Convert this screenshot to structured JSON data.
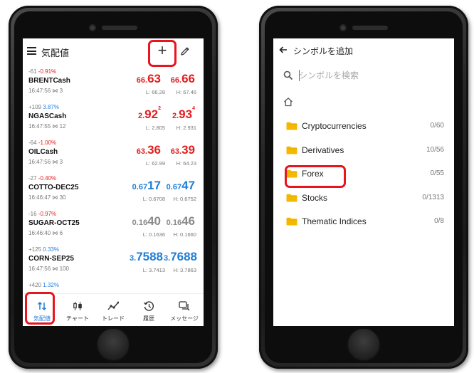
{
  "quotes_screen": {
    "title": "気配値",
    "add_button": "+",
    "rows": [
      {
        "chg_points": "-61",
        "chg_pct": "-0.91%",
        "dir": "neg",
        "symbol": "BRENTCash",
        "time": "16:47:56",
        "spread": "3",
        "bid": {
          "sm": "66.",
          "lg": "63",
          "sup": "",
          "color": "red"
        },
        "ask": {
          "sm": "66.",
          "lg": "66",
          "sup": "",
          "color": "red"
        },
        "low": "L: 66.28",
        "high": "H: 67.46"
      },
      {
        "chg_points": "+109",
        "chg_pct": "3.87%",
        "dir": "pos",
        "symbol": "NGASCash",
        "time": "16:47:55",
        "spread": "12",
        "bid": {
          "sm": "2.",
          "lg": "92",
          "sup": "2",
          "color": "red"
        },
        "ask": {
          "sm": "2.",
          "lg": "93",
          "sup": "4",
          "color": "red"
        },
        "low": "L: 2.805",
        "high": "H: 2.931"
      },
      {
        "chg_points": "-64",
        "chg_pct": "-1.00%",
        "dir": "neg",
        "symbol": "OILCash",
        "time": "16:47:56",
        "spread": "3",
        "bid": {
          "sm": "63.",
          "lg": "36",
          "sup": "",
          "color": "red"
        },
        "ask": {
          "sm": "63.",
          "lg": "39",
          "sup": "",
          "color": "red"
        },
        "low": "L: 62.99",
        "high": "H: 64.23"
      },
      {
        "chg_points": "-27",
        "chg_pct": "-0.40%",
        "dir": "neg",
        "symbol": "COTTO-DEC25",
        "time": "16:46:47",
        "spread": "30",
        "bid": {
          "sm": "0.67",
          "lg": "17",
          "sup": "",
          "color": "blue"
        },
        "ask": {
          "sm": "0.67",
          "lg": "47",
          "sup": "",
          "color": "blue"
        },
        "low": "L: 0.6708",
        "high": "H: 0.6752"
      },
      {
        "chg_points": "-16",
        "chg_pct": "-0.97%",
        "dir": "neg",
        "symbol": "SUGAR-OCT25",
        "time": "16:46:40",
        "spread": "6",
        "bid": {
          "sm": "0.16",
          "lg": "40",
          "sup": "",
          "color": "gray"
        },
        "ask": {
          "sm": "0.16",
          "lg": "46",
          "sup": "",
          "color": "gray"
        },
        "low": "L: 0.1636",
        "high": "H: 0.1660"
      },
      {
        "chg_points": "+125",
        "chg_pct": "0.33%",
        "dir": "pos",
        "symbol": "CORN-SEP25",
        "time": "16:47:56",
        "spread": "100",
        "bid": {
          "sm": "3.",
          "lg": "7588",
          "sup": "",
          "color": "blue"
        },
        "ask": {
          "sm": "3.",
          "lg": "7688",
          "sup": "",
          "color": "blue"
        },
        "low": "L: 3.7413",
        "high": "H: 3.7863"
      }
    ],
    "partial_row": {
      "chg_points": "+420",
      "chg_pct": "1.32%"
    },
    "tabs": [
      {
        "label": "気配値",
        "icon": "arrows-updown-icon",
        "active": true
      },
      {
        "label": "チャート",
        "icon": "candlestick-icon",
        "active": false
      },
      {
        "label": "トレード",
        "icon": "trade-line-icon",
        "active": false
      },
      {
        "label": "履歴",
        "icon": "history-icon",
        "active": false
      },
      {
        "label": "メッセージ",
        "icon": "messages-icon",
        "active": false
      }
    ]
  },
  "symbols_screen": {
    "title": "シンボルを追加",
    "search_placeholder": "シンボルを検索",
    "folders": [
      {
        "name": "Cryptocurrencies",
        "count": "0/60"
      },
      {
        "name": "Derivatives",
        "count": "10/56"
      },
      {
        "name": "Forex",
        "count": "0/55"
      },
      {
        "name": "Stocks",
        "count": "0/1313"
      },
      {
        "name": "Thematic Indices",
        "count": "0/8"
      }
    ]
  },
  "colors": {
    "negative": "#e02020",
    "positive": "#2a7de1",
    "price_blue": "#1f7ed6",
    "highlight": "#e8141e",
    "folder": "#f5b800"
  }
}
